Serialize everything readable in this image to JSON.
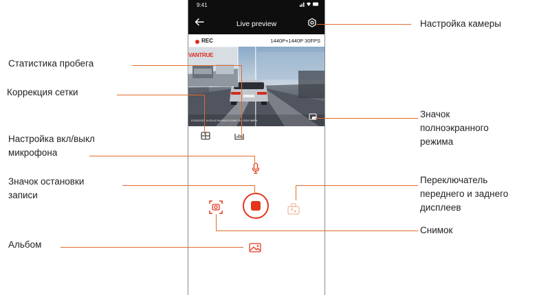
{
  "phone": {
    "status_time": "9:41",
    "status_icons": "..ıl ᯤ ▬",
    "title": "Live preview",
    "rec_label": "REC",
    "resolution_label": "1440P+1440P 30FPS",
    "brand_overlay": "VANTRUE",
    "video_timestamp": "07/01/2023 14:21:42  N:0.000  E:0.000  114.0310 0MPH"
  },
  "callouts": {
    "camera_settings": "Настройка камеры",
    "trip_stats": "Статистика пробега",
    "grid_correction": "Коррекция сетки",
    "fullscreen_line1": "Значок",
    "fullscreen_line2": "полноэкранного",
    "fullscreen_line3": "режима",
    "mic_line1": "Настройка вкл/выкл",
    "mic_line2": "микрофона",
    "stop_line1": "Значок остановки",
    "stop_line2": "записи",
    "switch_line1": "Переключатель",
    "switch_line2": "переднего и заднего",
    "switch_line3": "дисплеев",
    "snapshot": "Снимок",
    "album": "Альбом"
  },
  "colors": {
    "accent": "#e3361d",
    "leader": "#e06b2b",
    "header_bg": "#0e0e0e"
  },
  "icons": [
    "back-arrow-icon",
    "gear-icon",
    "fullscreen-icon",
    "grid-icon",
    "stats-icon",
    "mic-icon",
    "photo-icon",
    "stop-icon",
    "camera-switch-icon",
    "album-icon"
  ]
}
